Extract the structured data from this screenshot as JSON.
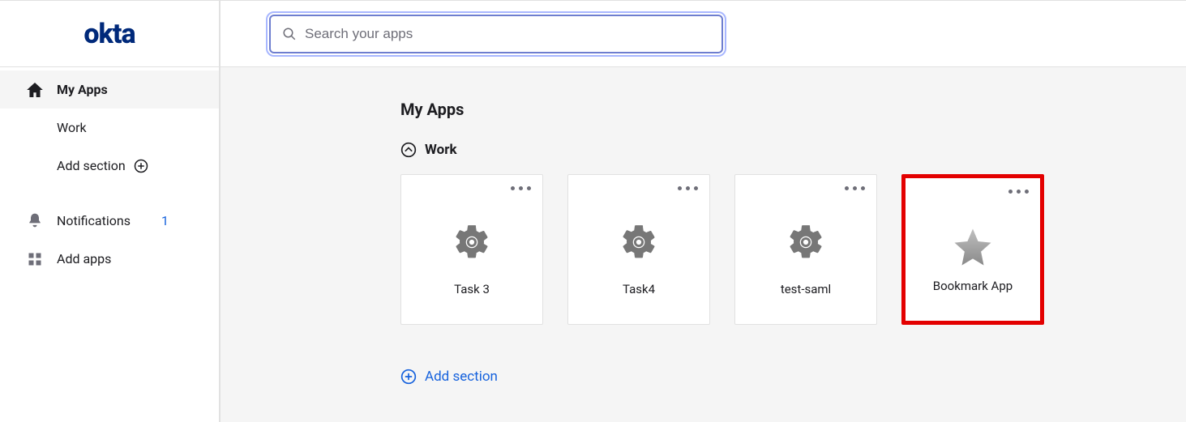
{
  "brand": "okta",
  "search": {
    "placeholder": "Search your apps"
  },
  "sidebar": {
    "items": [
      {
        "label": "My Apps",
        "icon": "home-icon"
      },
      {
        "label": "Work"
      },
      {
        "label": "Add section",
        "icon": "plus-circle-icon"
      }
    ],
    "secondary": [
      {
        "label": "Notifications",
        "icon": "bell-icon",
        "badge": "1"
      },
      {
        "label": "Add apps",
        "icon": "grid-icon"
      }
    ]
  },
  "main": {
    "title": "My Apps",
    "section": {
      "label": "Work"
    },
    "cards": [
      {
        "label": "Task 3",
        "icon": "gear-icon",
        "highlight": false
      },
      {
        "label": "Task4",
        "icon": "gear-icon",
        "highlight": false
      },
      {
        "label": "test-saml",
        "icon": "gear-icon",
        "highlight": false
      },
      {
        "label": "Bookmark App",
        "icon": "star-icon",
        "highlight": true
      }
    ],
    "footer_action": "Add section"
  }
}
